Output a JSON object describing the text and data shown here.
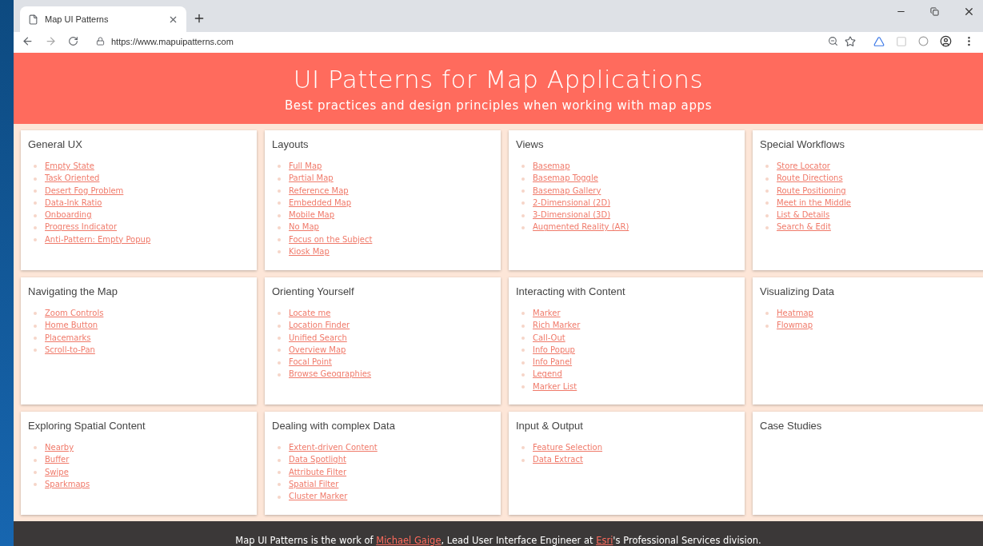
{
  "browser": {
    "tab": {
      "title": "Map UI Patterns",
      "selected": true
    },
    "url": "https://www.mapuipatterns.com"
  },
  "header": {
    "title": "UI Patterns for Map Applications",
    "subtitle": "Best practices and design principles when working with map apps"
  },
  "sections": [
    {
      "title": "General UX",
      "links": [
        "Empty State",
        "Task Oriented",
        "Desert Fog Problem",
        "Data-Ink Ratio",
        "Onboarding",
        "Progress Indicator",
        "Anti-Pattern: Empty Popup"
      ]
    },
    {
      "title": "Layouts",
      "links": [
        "Full Map",
        "Partial Map",
        "Reference Map",
        "Embedded Map",
        "Mobile Map",
        "No Map",
        "Focus on the Subject",
        "Kiosk Map"
      ]
    },
    {
      "title": "Views",
      "links": [
        "Basemap",
        "Basemap Toggle",
        "Basemap Gallery",
        "2-Dimensional (2D)",
        "3-Dimensional (3D)",
        "Augmented Reality (AR)"
      ]
    },
    {
      "title": "Special Workflows",
      "links": [
        "Store Locator",
        "Route Directions",
        "Route Positioning",
        "Meet in the Middle",
        "List & Details",
        "Search & Edit"
      ]
    },
    {
      "title": "Navigating the Map",
      "links": [
        "Zoom Controls",
        "Home Button",
        "Placemarks",
        "Scroll-to-Pan"
      ]
    },
    {
      "title": "Orienting Yourself",
      "links": [
        "Locate me",
        "Location Finder",
        "Unified Search",
        "Overview Map",
        "Focal Point",
        "Browse Geographies"
      ]
    },
    {
      "title": "Interacting with Content",
      "links": [
        "Marker",
        "Rich Marker",
        "Call-Out",
        "Info Popup",
        "Info Panel",
        "Legend",
        "Marker List"
      ]
    },
    {
      "title": "Visualizing Data",
      "links": [
        "Heatmap",
        "Flowmap"
      ]
    },
    {
      "title": "Exploring Spatial Content",
      "links": [
        "Nearby",
        "Buffer",
        "Swipe",
        "Sparkmaps"
      ]
    },
    {
      "title": "Dealing with complex Data",
      "links": [
        "Extent-driven Content",
        "Data Spotlight",
        "Attribute Filter",
        "Spatial Filter",
        "Cluster Marker"
      ]
    },
    {
      "title": "Input & Output",
      "links": [
        "Feature Selection",
        "Data Extract"
      ]
    },
    {
      "title": "Case Studies"
    }
  ],
  "footer": {
    "parts": [
      {
        "kind": "text",
        "text": "Map UI Patterns is the work of "
      },
      {
        "kind": "link",
        "text": "Michael Gaige"
      },
      {
        "kind": "text",
        "text": ", Lead User Interface Engineer at "
      },
      {
        "kind": "link",
        "text": "Esri"
      },
      {
        "kind": "text",
        "text": "'s Professional Services division."
      }
    ]
  }
}
